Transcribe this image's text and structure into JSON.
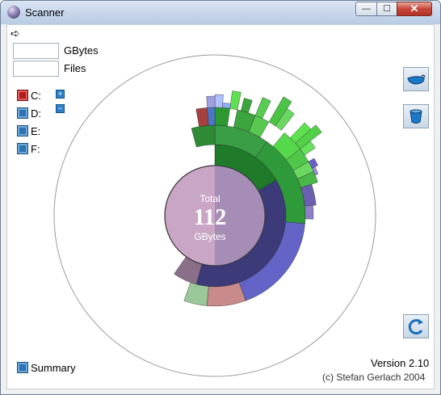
{
  "window": {
    "title": "Scanner",
    "close_glyph": "✕",
    "min_glyph": "—",
    "max_glyph": "☐"
  },
  "toolbar": {
    "arrow_icon": "arrow-right-icon",
    "arrow_glyph": "➪"
  },
  "stats": {
    "gbytes_label": "GBytes",
    "gbytes_value": "",
    "files_label": "Files",
    "files_value": ""
  },
  "drives": [
    {
      "label": "C:",
      "selected": true
    },
    {
      "label": "D:",
      "selected": false
    },
    {
      "label": "E:",
      "selected": false
    },
    {
      "label": "F:",
      "selected": false
    }
  ],
  "expand": {
    "plus_glyph": "+",
    "minus_glyph": "−"
  },
  "center": {
    "caption_top": "Total",
    "value": "112",
    "caption_bottom": "GBytes"
  },
  "side_buttons": [
    "tub-icon",
    "cup-icon",
    "refresh-icon"
  ],
  "footer": {
    "version": "Version 2.10",
    "copyright": "(c) Stefan Gerlach 2004",
    "summary": "Summary"
  },
  "colors": {
    "center_fill": "#c9a6c6",
    "ring_blue": "#3c3a78",
    "green": "#2f9a3a",
    "lime": "#55d84a",
    "accent": "#2d74b3"
  }
}
